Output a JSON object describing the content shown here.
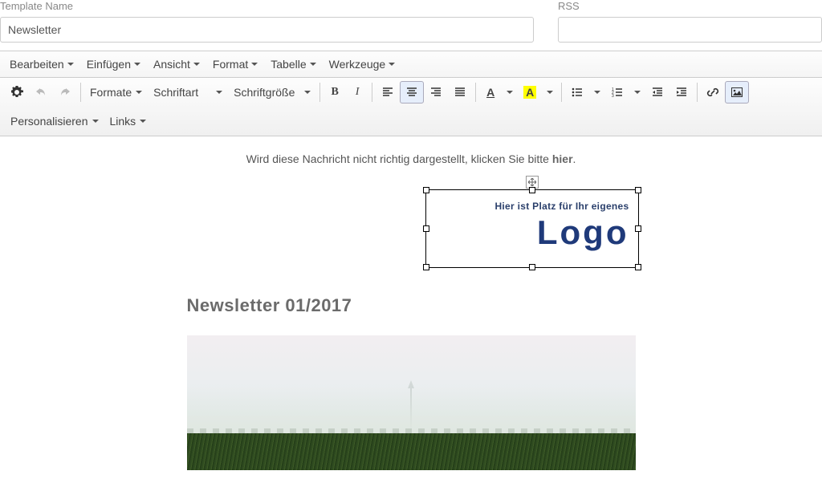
{
  "fields": {
    "templateNameLabel": "Template Name",
    "templateNameValue": "Newsletter",
    "rssLabel": "RSS",
    "rssValue": ""
  },
  "menubar": {
    "edit": "Bearbeiten",
    "insert": "Einfügen",
    "view": "Ansicht",
    "format": "Format",
    "table": "Tabelle",
    "tools": "Werkzeuge"
  },
  "toolbar": {
    "formats": "Formate",
    "fontFamily": "Schriftart",
    "fontSize": "Schriftgröße",
    "personalize": "Personalisieren",
    "links": "Links"
  },
  "preview": {
    "noticePrefix": "Wird diese Nachricht nicht richtig dargestellt, klicken Sie bitte ",
    "noticeLink": "hier",
    "noticeSuffix": "."
  },
  "content": {
    "logoSub": "Hier ist Platz für Ihr eigenes",
    "logoMain": "Logo",
    "title": "Newsletter 01/2017"
  }
}
